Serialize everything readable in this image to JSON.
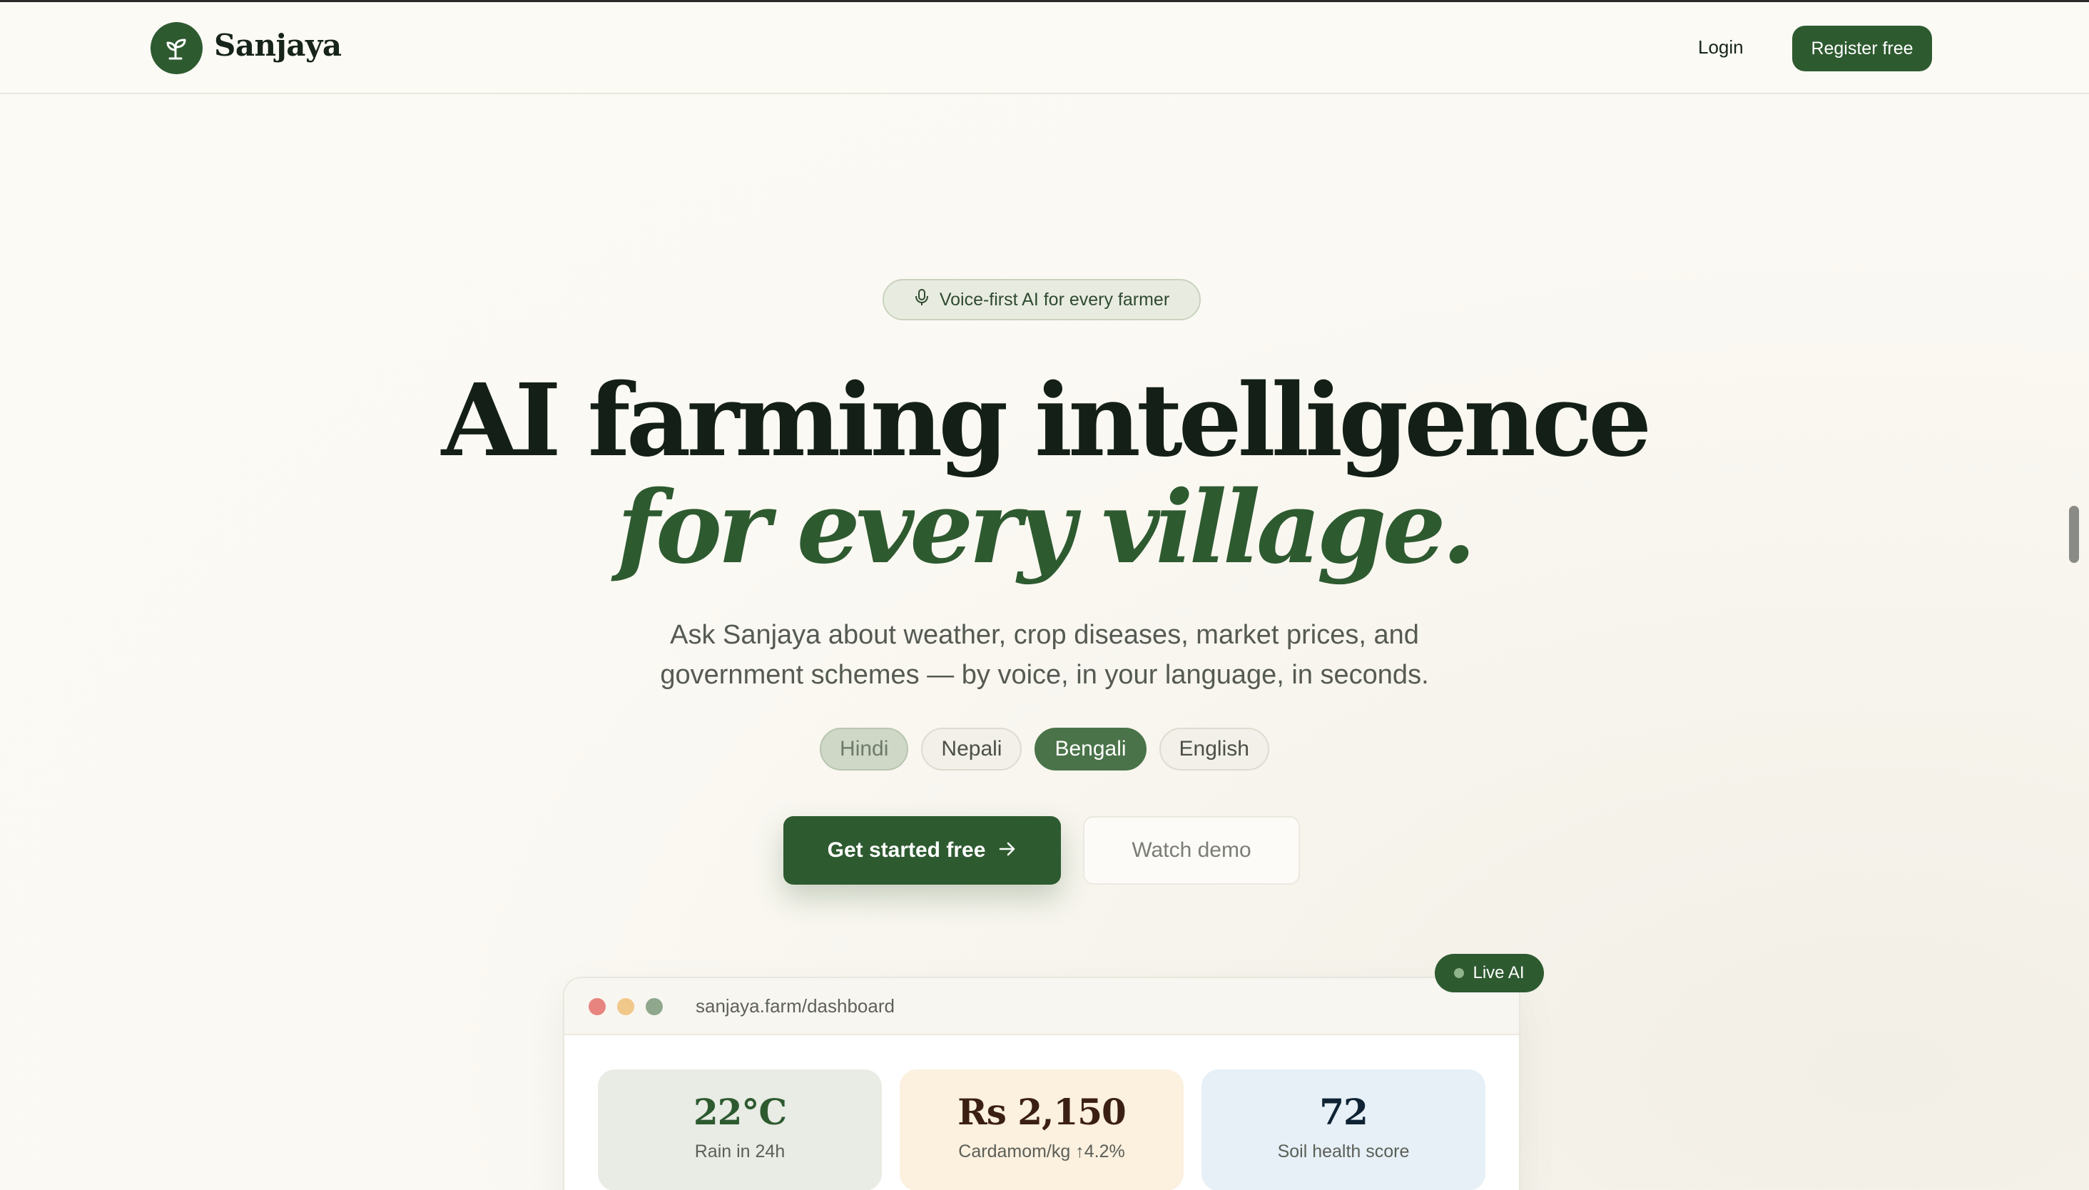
{
  "header": {
    "brand": "Sanjaya",
    "login_label": "Login",
    "register_label": "Register free"
  },
  "hero": {
    "badge_text": "Voice-first AI for every farmer",
    "title_line1": "AI farming intelligence",
    "title_line2": "for every village.",
    "subtitle_line1": "Ask Sanjaya about weather, crop diseases, market prices, and",
    "subtitle_line2": "government schemes — by voice, in your language, in seconds.",
    "languages": [
      "Hindi",
      "Nepali",
      "Bengali",
      "English"
    ],
    "active_language": "Bengali",
    "cta_primary": "Get started free",
    "cta_secondary": "Watch demo"
  },
  "dashboard": {
    "live_badge": "Live AI",
    "url": "sanjaya.farm/dashboard",
    "cards": [
      {
        "value": "22°C",
        "label": "Rain in 24h"
      },
      {
        "value": "Rs 2,150",
        "label": "Cardamom/kg ↑4.2%"
      },
      {
        "value": "72",
        "label": "Soil health score"
      }
    ]
  },
  "colors": {
    "brand_green": "#2e5a30",
    "background": "#fcfaf5"
  },
  "icons": {
    "logo": "sprout-icon",
    "badge": "microphone-icon",
    "cta": "arrow-right-icon"
  }
}
